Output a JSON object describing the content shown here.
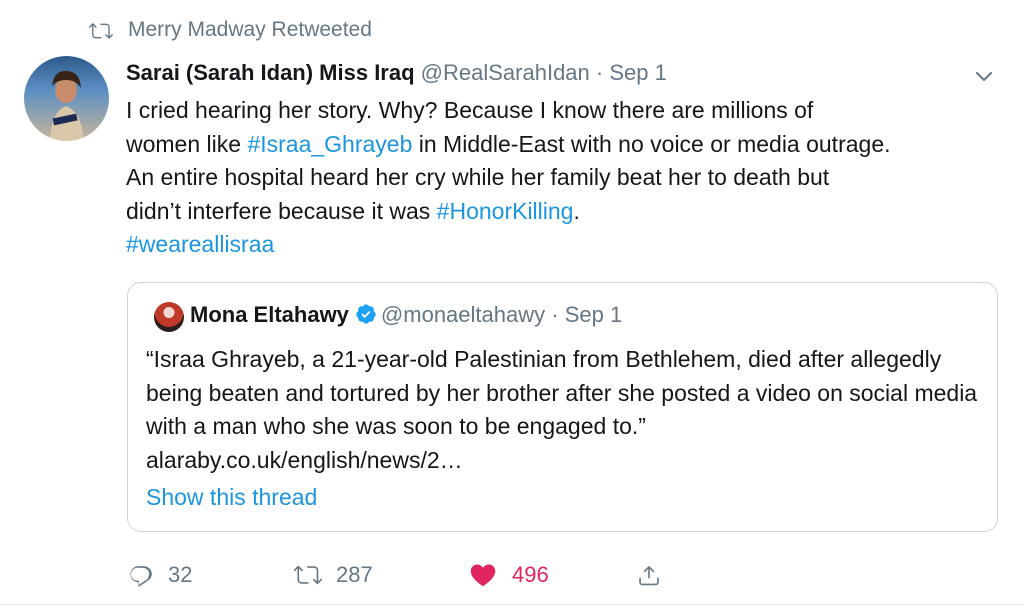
{
  "retweet_context": {
    "text": "Merry Madway Retweeted"
  },
  "tweet": {
    "author_name": "Sarai (Sarah Idan) Miss Iraq",
    "handle": "@RealSarahIdan",
    "separator": "·",
    "date": "Sep 1",
    "text_lines": [
      "I cried hearing her story. Why? Because I know there are millions of",
      "women like ",
      " in Middle-East with no voice or media outrage.",
      "An entire hospital heard her cry while her family beat her to death but",
      "didn’t interfere because it was ",
      "."
    ],
    "hashtags": [
      "#Israa_Ghrayeb",
      "#HonorKilling",
      "#weareallisraa"
    ],
    "icons": {
      "retweet_context": "retweet-icon",
      "menu": "chevron-down-icon"
    }
  },
  "quote": {
    "author_name": "Mona Eltahawy",
    "handle": "@monaeltahawy",
    "separator": "·",
    "date": "Sep 1",
    "text": "“Israa Ghrayeb, a 21-year-old Palestinian from Bethlehem, died after allegedly being beaten and tortured by her brother after she posted a video on social media with a man who she was soon to be engaged to.”",
    "link": "alaraby.co.uk/english/news/2…",
    "show_thread": "Show this thread"
  },
  "actions": {
    "reply_count": "32",
    "retweet_count": "287",
    "like_count": "496"
  },
  "colors": {
    "link": "#1b95e0",
    "muted": "#657786",
    "like": "#e0245e",
    "border": "#ccd6dd"
  }
}
